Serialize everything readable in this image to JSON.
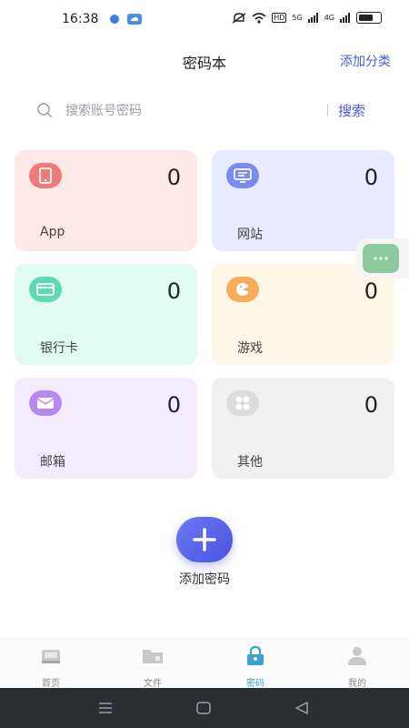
{
  "status": {
    "time": "16:38",
    "hd": "HD",
    "net1": "5G",
    "net2": "4G"
  },
  "header": {
    "title": "密码本",
    "add_category": "添加分类"
  },
  "search": {
    "placeholder": "搜索账号密码",
    "button": "搜索"
  },
  "categories": [
    {
      "label": "App",
      "count": "0",
      "bg": "#fde8e8",
      "icon_bg": "#f07a7a",
      "icon": "phone-icon"
    },
    {
      "label": "网站",
      "count": "0",
      "bg": "#e8ebfd",
      "icon_bg": "#7a8bf0",
      "icon": "monitor-icon"
    },
    {
      "label": "银行卡",
      "count": "0",
      "bg": "#e2fbf2",
      "icon_bg": "#5fd9b3",
      "icon": "card-icon"
    },
    {
      "label": "游戏",
      "count": "0",
      "bg": "#fff6e8",
      "icon_bg": "#f5ad5c",
      "icon": "game-icon"
    },
    {
      "label": "邮箱",
      "count": "0",
      "bg": "#f3eafd",
      "icon_bg": "#b78af0",
      "icon": "mail-icon"
    },
    {
      "label": "其他",
      "count": "0",
      "bg": "#f0f0f0",
      "icon_bg": "#dcdcdc",
      "icon": "grid-icon"
    }
  ],
  "add_password": {
    "label": "添加密码"
  },
  "tabs": [
    {
      "label": "首页",
      "icon": "home-icon",
      "active": false
    },
    {
      "label": "文件",
      "icon": "folder-icon",
      "active": false
    },
    {
      "label": "密码",
      "icon": "lock-icon",
      "active": true
    },
    {
      "label": "我的",
      "icon": "user-icon",
      "active": false
    }
  ],
  "colors": {
    "accent": "#4a5bd6",
    "active_tab": "#3aa0d8"
  }
}
